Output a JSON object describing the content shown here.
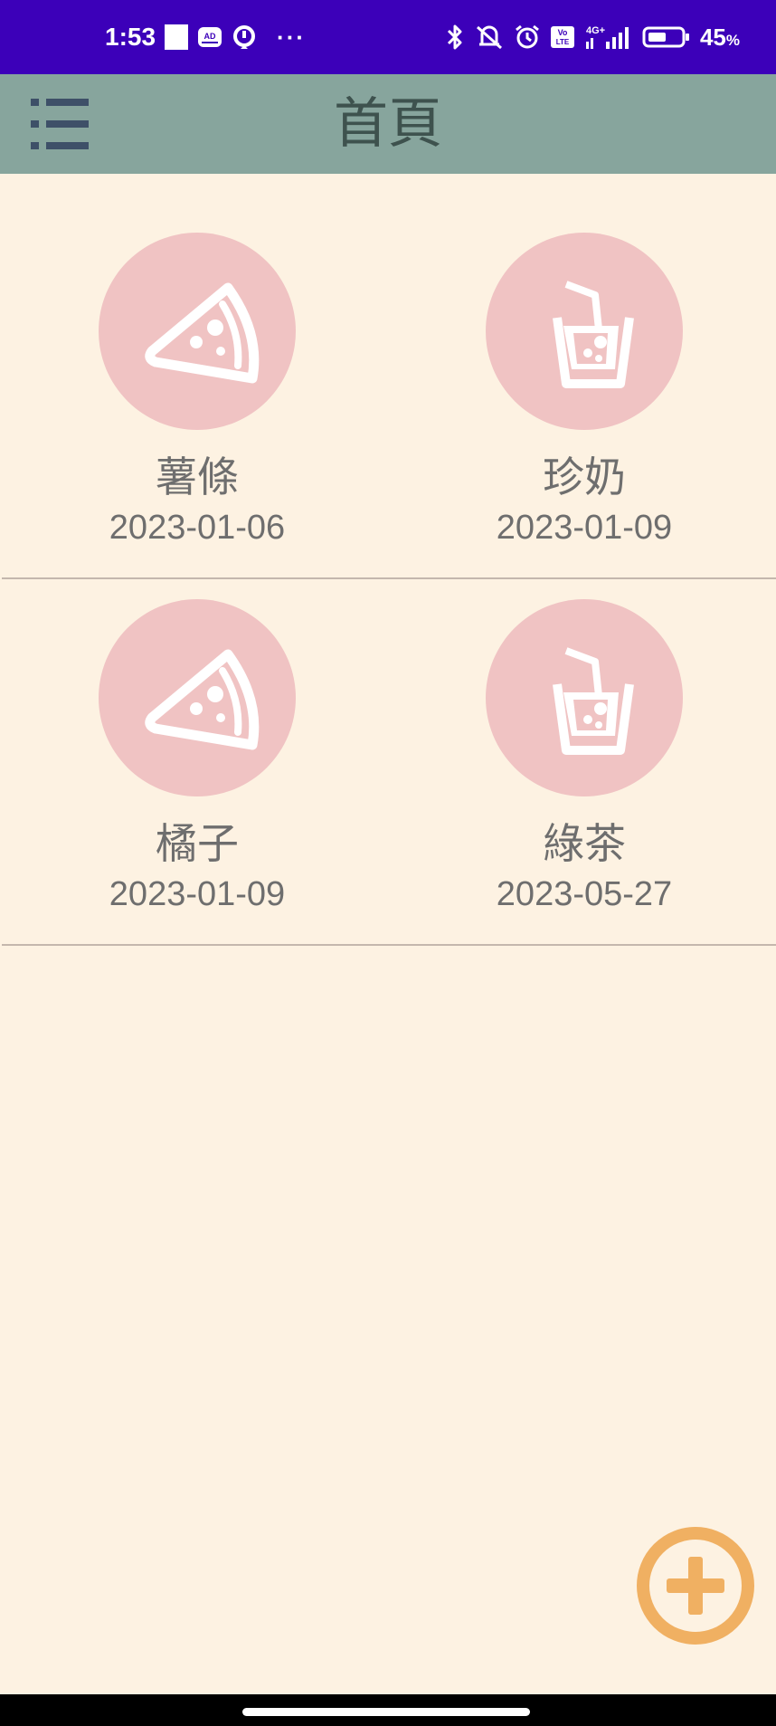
{
  "status_bar": {
    "time": "1:53",
    "battery": "45",
    "battery_unit": "%",
    "left_icons": [
      "white-square-icon",
      "ad-blocker-icon",
      "location-icon",
      "more-dots-icon"
    ],
    "right_icons": [
      "bluetooth-icon",
      "vibrate-off-icon",
      "alarm-icon",
      "volte-icon",
      "signal-4g-icon",
      "battery-icon"
    ],
    "network_label": "4G+",
    "volte_label": "Vo LTE"
  },
  "app_bar": {
    "title": "首頁",
    "menu_icon": "list-menu-icon",
    "color": "#87a59d"
  },
  "items": [
    {
      "name": "薯條",
      "date": "2023-01-06",
      "icon": "pizza-slice-icon"
    },
    {
      "name": "珍奶",
      "date": "2023-01-09",
      "icon": "drink-cup-icon"
    },
    {
      "name": "橘子",
      "date": "2023-01-09",
      "icon": "pizza-slice-icon"
    },
    {
      "name": "綠茶",
      "date": "2023-05-27",
      "icon": "drink-cup-icon"
    }
  ],
  "fab": {
    "icon": "add-circle-icon",
    "color": "#f0b062"
  },
  "colors": {
    "background": "#fdf2e2",
    "status_bar": "#3c00b9",
    "icon_circle": "#f0c3c3",
    "text": "#6e6e6e"
  }
}
